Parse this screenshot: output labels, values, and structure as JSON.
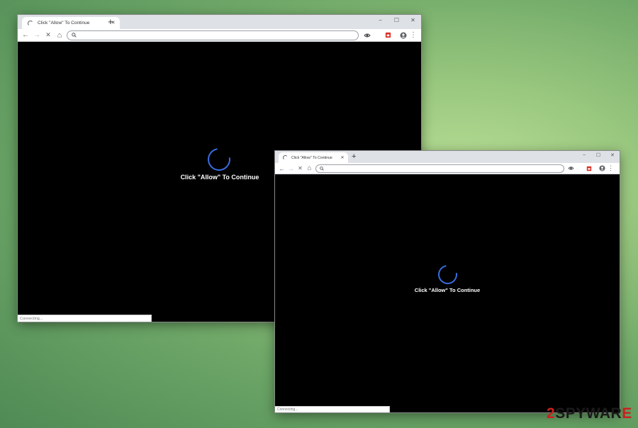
{
  "windows": [
    {
      "tab_title": "Click \"Allow\" To Continue",
      "address_value": "",
      "message": "Click \"Allow\" To Continue",
      "status_text": "Connecting..."
    },
    {
      "tab_title": "Click \"Allow\" To Continue",
      "address_value": "",
      "message": "Click \"Allow\" To Continue",
      "status_text": "Connecting..."
    }
  ],
  "glyphs": {
    "close": "✕",
    "new_tab": "+",
    "minimize": "−",
    "maximize": "☐",
    "window_close": "✕",
    "back": "←",
    "forward": "→",
    "stop": "✕",
    "home": "⌂",
    "menu": "⋮"
  },
  "watermark": {
    "prefix": "2",
    "middle": "SPYWAR",
    "suffix": "E"
  },
  "colors": {
    "spinner": "#3a6de0",
    "content_bg": "#000000",
    "extension_icon": "#d93025"
  }
}
